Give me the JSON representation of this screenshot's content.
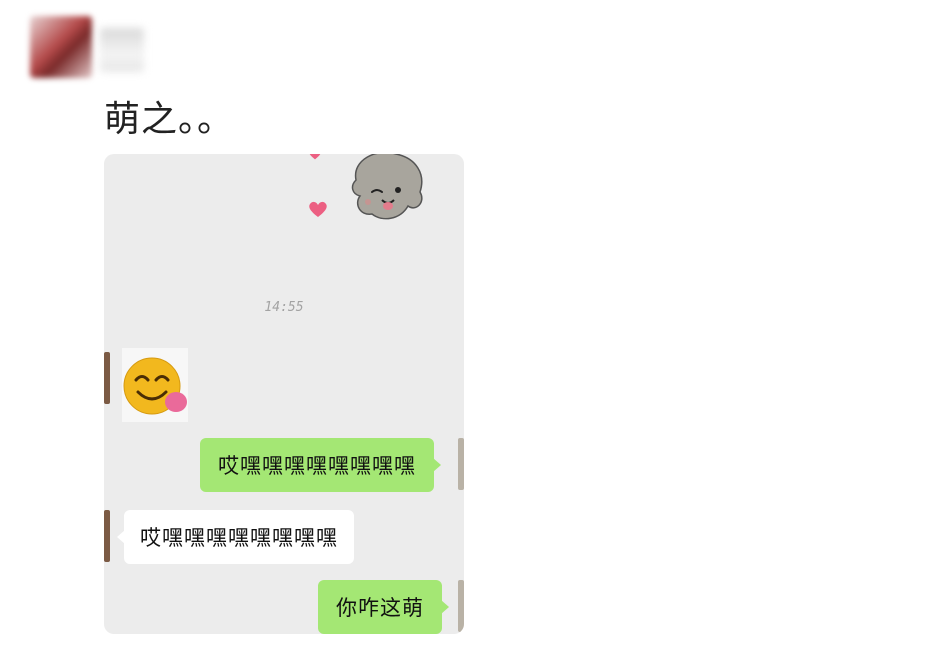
{
  "post": {
    "caption": "萌之。。"
  },
  "chat": {
    "timestamp": "14:55",
    "messages": [
      {
        "side": "theirs",
        "kind": "emoji",
        "icon": "smiling-face-emoji"
      },
      {
        "side": "mine",
        "text": "哎嘿嘿嘿嘿嘿嘿嘿嘿"
      },
      {
        "side": "theirs",
        "text": "哎嘿嘿嘿嘿嘿嘿嘿嘿"
      },
      {
        "side": "mine",
        "text": "你咋这萌"
      }
    ]
  },
  "colors": {
    "my_bubble": "#a4e774",
    "their_bubble": "#ffffff",
    "chat_background": "#ececec"
  }
}
